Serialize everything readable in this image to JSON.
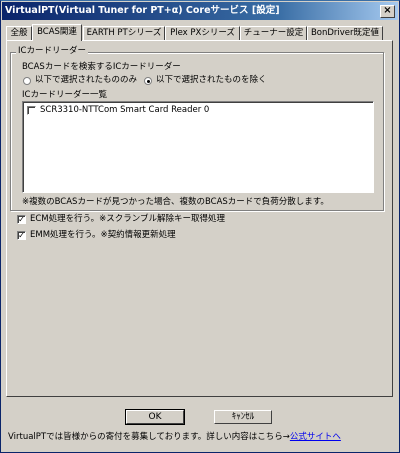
{
  "window": {
    "title": "VirtualPT(Virtual Tuner for PT+α) Coreサービス [設定]",
    "close_glyph": "×"
  },
  "tabs": [
    "全般",
    "BCAS関連",
    "EARTH PTシリーズ",
    "Plex PXシリーズ",
    "チューナー設定",
    "BonDriver既定値"
  ],
  "active_tab": 1,
  "group": {
    "title": "ICカードリーダー",
    "search_label": "BCASカードを検索するICカードリーダー",
    "radio_only": "以下で選択されたもののみ",
    "radio_exclude": "以下で選択されたものを除く",
    "radio_selected": "exclude",
    "list_label": "ICカードリーダー一覧",
    "list_items": [
      {
        "label": "SCR3310-NTTCom Smart Card Reader 0",
        "checked": false
      }
    ],
    "note": "※複数のBCASカードが見つかった場合、複数のBCASカードで負荷分散します。"
  },
  "options": {
    "ecm_label": "ECM処理を行う。※スクランブル解除キー取得処理",
    "ecm_checked": true,
    "emm_label": "EMM処理を行う。※契約情報更新処理",
    "emm_checked": true
  },
  "buttons": {
    "ok": "OK",
    "cancel": "ｷｬﾝｾﾙ"
  },
  "footer": {
    "text": "VirtualPTでは皆様からの寄付を募集しております。詳しい内容はこちら→",
    "link": "公式サイトへ"
  }
}
